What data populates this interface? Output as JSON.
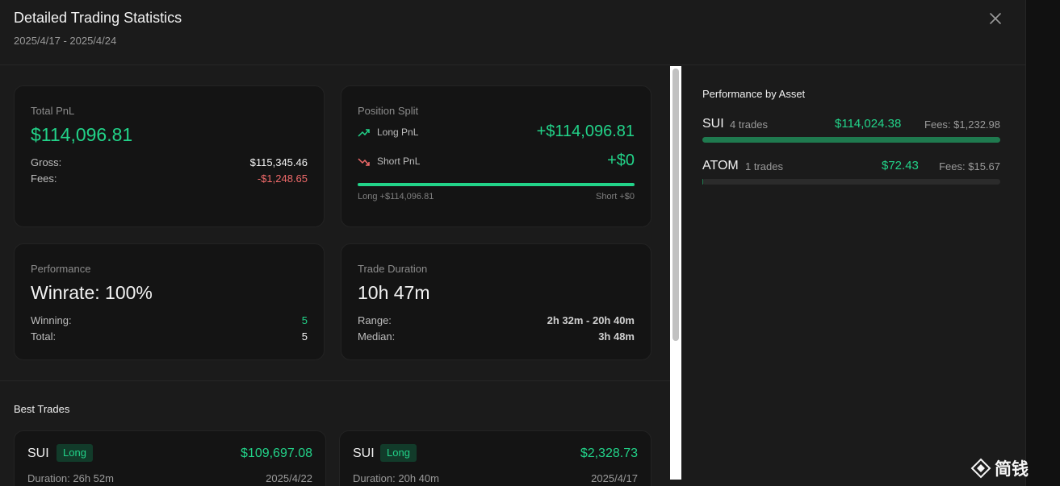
{
  "header": {
    "title": "Detailed Trading Statistics",
    "date_range": "2025/4/17 - 2025/4/24"
  },
  "total_pnl": {
    "label": "Total PnL",
    "value": "$114,096.81",
    "gross_label": "Gross:",
    "gross_value": "$115,345.46",
    "fees_label": "Fees:",
    "fees_value": "-$1,248.65"
  },
  "position_split": {
    "label": "Position Split",
    "long_label": "Long PnL",
    "long_value": "+$114,096.81",
    "short_label": "Short PnL",
    "short_value": "+$0",
    "long_share": 1.0,
    "bar_long_caption": "Long +$114,096.81",
    "bar_short_caption": "Short +$0"
  },
  "performance": {
    "label": "Performance",
    "winrate": "Winrate: 100%",
    "winning_label": "Winning:",
    "winning_value": "5",
    "total_label": "Total:",
    "total_value": "5"
  },
  "duration": {
    "label": "Trade Duration",
    "value": "10h 47m",
    "range_label": "Range:",
    "range_value": "2h 32m - 20h 40m",
    "median_label": "Median:",
    "median_value": "3h 48m"
  },
  "best_trades": {
    "title": "Best Trades",
    "trades": [
      {
        "asset": "SUI",
        "side": "Long",
        "pnl": "$109,697.08",
        "duration": "Duration: 26h 52m",
        "date": "2025/4/22"
      },
      {
        "asset": "SUI",
        "side": "Long",
        "pnl": "$2,328.73",
        "duration": "Duration: 20h 40m",
        "date": "2025/4/17"
      }
    ]
  },
  "assets": {
    "title": "Performance by Asset",
    "items": [
      {
        "name": "SUI",
        "trades": "4 trades",
        "pnl": "$114,024.38",
        "fees": "Fees: $1,232.98",
        "share": 0.999
      },
      {
        "name": "ATOM",
        "trades": "1 trades",
        "pnl": "$72.43",
        "fees": "Fees: $15.67",
        "share": 0.0006
      }
    ]
  },
  "watermark": "简钱",
  "colors": {
    "positive": "#22d389",
    "negative": "#f06a6a",
    "background": "#1b1b1b"
  }
}
